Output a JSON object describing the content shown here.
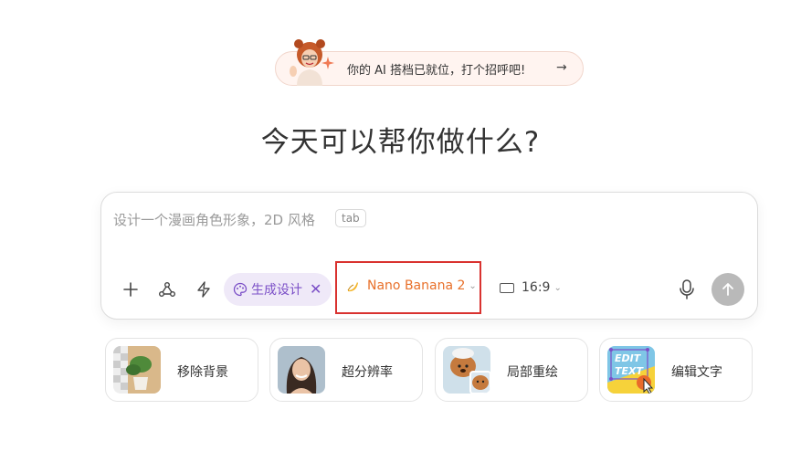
{
  "banner": {
    "text": "你的 AI 搭档已就位，打个招呼吧!",
    "arrow": "→"
  },
  "headline": "今天可以帮你做什么?",
  "composer": {
    "placeholder": "设计一个漫画角色形象，2D 风格",
    "tab_hint": "tab",
    "mode_chip": "生成设计",
    "mode_close": "✕",
    "model": "Nano Banana 2",
    "ratio": "16:9",
    "chevron": "⌄"
  },
  "features": [
    {
      "label": "移除背景",
      "icon": "potted-plant-thumbnail"
    },
    {
      "label": "超分辨率",
      "icon": "portrait-thumbnail"
    },
    {
      "label": "局部重绘",
      "icon": "puppy-thumbnail"
    },
    {
      "label": "编辑文字",
      "icon": "edit-text-thumbnail"
    }
  ],
  "colors": {
    "accent_purple": "#7b4fc7",
    "model_orange": "#e8702a",
    "highlight_red": "#d9322f"
  }
}
